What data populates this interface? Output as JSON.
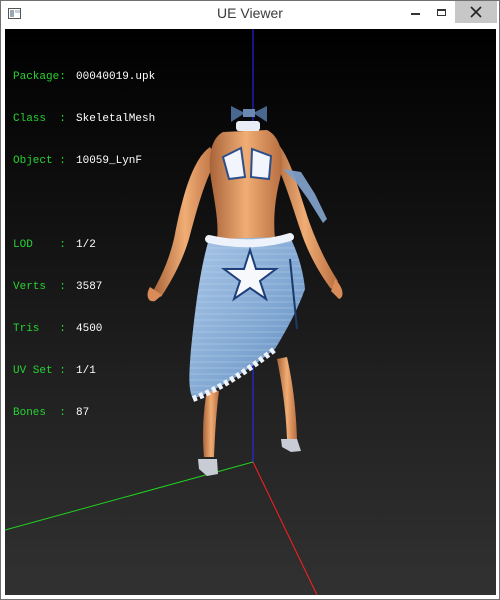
{
  "window": {
    "title": "UE Viewer"
  },
  "controls": {
    "minimize": "minimize",
    "maximize": "maximize",
    "close": "close"
  },
  "info": {
    "package_label": "Package:",
    "package_value": "00040019.upk",
    "class_label": "Class  :",
    "class_value": "SkeletalMesh",
    "object_label": "Object :",
    "object_value": "10059_LynF",
    "lod_label": "LOD    :",
    "lod_value": "1/2",
    "verts_label": "Verts  :",
    "verts_value": "3587",
    "tris_label": "Tris   :",
    "tris_value": "4500",
    "uvset_label": "UV Set :",
    "uvset_value": "1/1",
    "bones_label": "Bones  :",
    "bones_value": "87"
  },
  "colors": {
    "viewport_top": "#000000",
    "viewport_bottom": "#313131",
    "info_label": "#27d233",
    "info_value": "#ffffff",
    "axis_x": "#ff1f1f",
    "axis_y": "#1fd11f",
    "axis_z": "#2a2aff",
    "skin": "#e29a63",
    "skirt": "#8fb3d9",
    "trim": "#f2f5fb"
  },
  "icons": {
    "app": "app-window-icon",
    "close": "close-x-icon"
  }
}
